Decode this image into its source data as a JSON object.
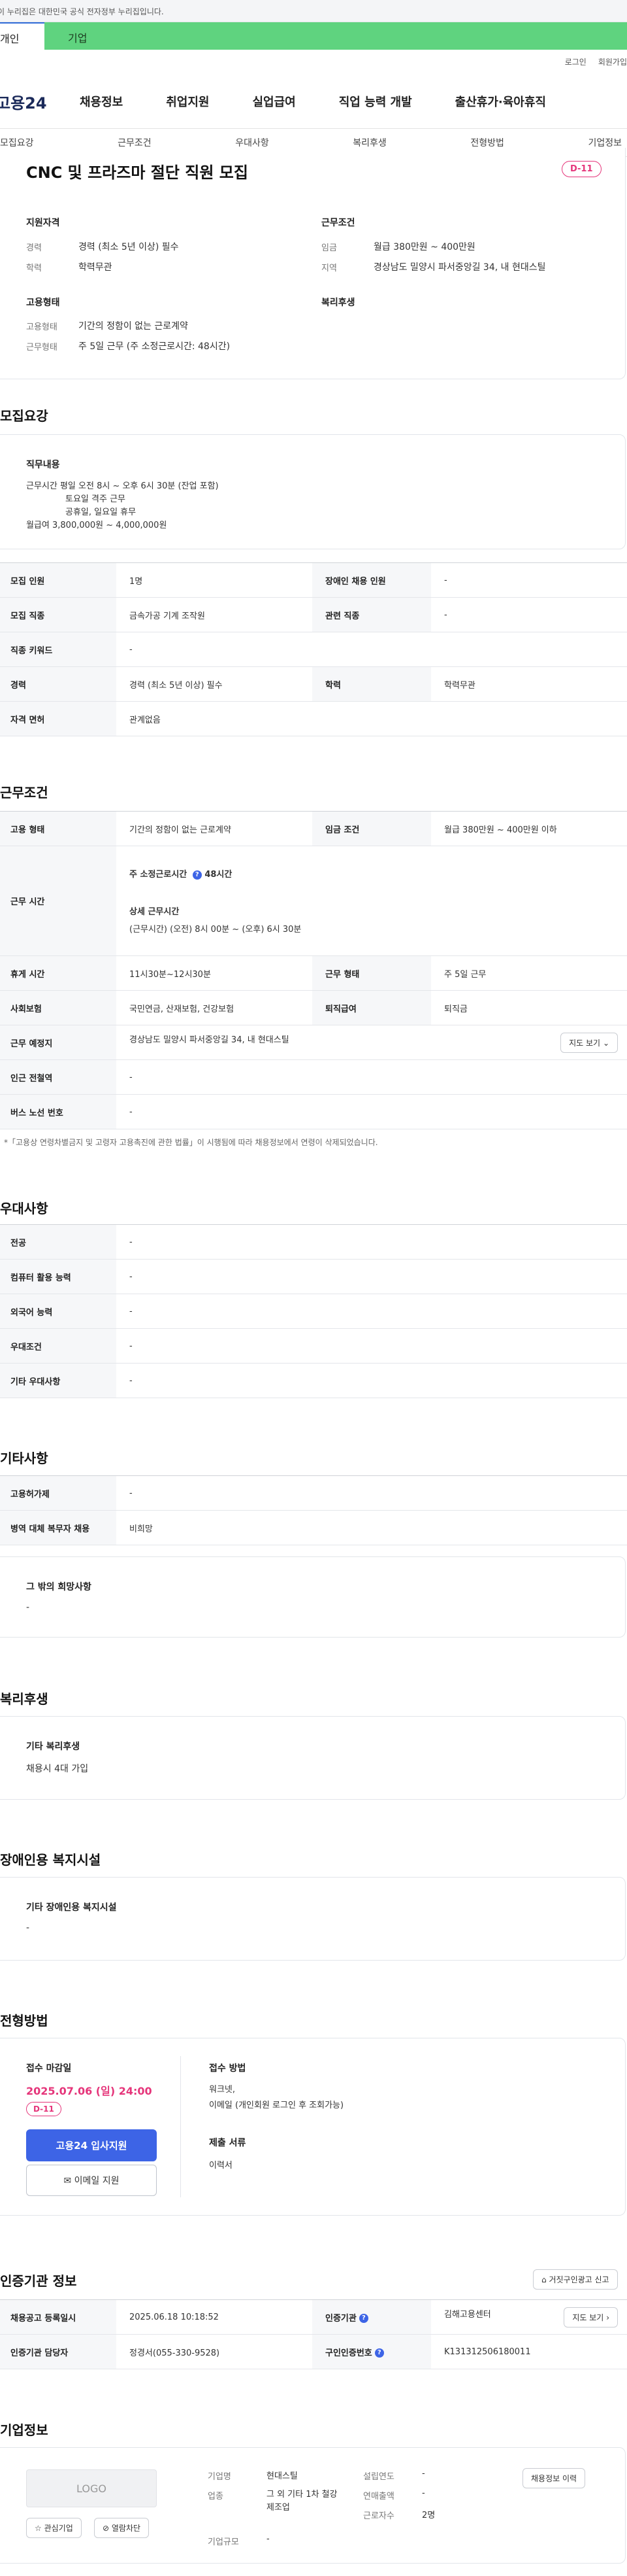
{
  "gov_banner": "이 누리집은 대한민국 공식 전자정부 누리집입니다.",
  "tabs": {
    "personal": "개인",
    "company": "기업"
  },
  "util": {
    "login": "로그인",
    "signup": "회원가입"
  },
  "logo": "고용24",
  "gnb": [
    "채용정보",
    "취업지원",
    "실업급여",
    "직업 능력 개발",
    "출산휴가·육아휴직"
  ],
  "subnav": [
    "모집요강",
    "근무조건",
    "우대사항",
    "복리후생",
    "전형방법",
    "기업정보"
  ],
  "summary": {
    "title": "CNC 및 프라즈마 절단 직원 모집",
    "dday": "D-11",
    "qualification_label": "지원자격",
    "career_k": "경력",
    "career_v": "경력 (최소 5년 이상) 필수",
    "edu_k": "학력",
    "edu_v": "학력무관",
    "workcond_label": "근무조건",
    "wage_k": "임금",
    "wage_v": "월급 380만원 ~ 400만원",
    "region_k": "지역",
    "region_v": "경상남도 밀양시 파서중앙길 34, 내 현대스틸",
    "emptype_label": "고용형태",
    "emp_k": "고용형태",
    "emp_v": "기간의 정함이 없는 근로계약",
    "worktype_k": "근무형태",
    "worktype_v": "주 5일 근무 (주 소정근로시간: 48시간)",
    "welfare_label": "복리후생"
  },
  "recruit": {
    "title": "모집요강",
    "duty_label": "직무내용",
    "duty_lines": [
      "근무시간 평일 오전 8시 ~ 오후 6시 30분 (잔업 포함)",
      "토요일 격주 근무",
      "공휴일, 일요일 휴무",
      "월급여 3,800,000원 ~ 4,000,000원"
    ],
    "rows": [
      [
        "모집 인원",
        "1명",
        "장애인 채용 인원",
        "-"
      ],
      [
        "모집 직종",
        "금속가공 기계 조작원",
        "관련 직종",
        "-"
      ],
      [
        "직종 키워드",
        "-",
        "",
        ""
      ],
      [
        "경력",
        "경력 (최소 5년 이상) 필수",
        "학력",
        "학력무관"
      ],
      [
        "자격 면허",
        "관계없음",
        "",
        ""
      ]
    ]
  },
  "workcond": {
    "title": "근무조건",
    "emp_type_k": "고용 형태",
    "emp_type_v": "기간의 정함이 없는 근로계약",
    "wage_k": "임금 조건",
    "wage_v": "월급 380만원 ~ 400만원 이하",
    "hours_k": "근무 시간",
    "hours_weekly": "주 소정근로시간",
    "hours_weekly_v": "48시간",
    "hours_detail_label": "상세 근무시간",
    "hours_detail_v": "(근무시간) (오전) 8시 00분 ~ (오후) 6시 30분",
    "break_k": "휴게 시간",
    "break_v": "11시30분~12시30분",
    "worktype_k": "근무 형태",
    "worktype_v": "주 5일 근무",
    "insurance_k": "사회보험",
    "insurance_v": "국민연금, 산재보험, 건강보험",
    "severance_k": "퇴직급여",
    "severance_v": "퇴직금",
    "location_k": "근무 예정지",
    "location_v": "경상남도 밀양시 파서중앙길 34, 내 현대스틸",
    "map_btn": "지도 보기",
    "subway_k": "인근 전철역",
    "subway_v": "-",
    "bus_k": "버스 노선 번호",
    "bus_v": "-",
    "note": "*「고용상 연령차별금지 및 고령자 고용촉진에 관한 법률」이 시행됨에 따라 채용정보에서 연령이 삭제되었습니다."
  },
  "preference": {
    "title": "우대사항",
    "rows": [
      [
        "전공",
        "-"
      ],
      [
        "컴퓨터 활용 능력",
        "-"
      ],
      [
        "외국어 능력",
        "-"
      ],
      [
        "우대조건",
        "-"
      ],
      [
        "기타 우대사항",
        "-"
      ]
    ]
  },
  "etc": {
    "title": "기타사항",
    "rows": [
      [
        "고용허가제",
        "-"
      ],
      [
        "병역 대체 복무자 채용",
        "비희망"
      ]
    ],
    "wish_label": "그 밖의 희망사항",
    "wish_v": "-"
  },
  "welfare": {
    "title": "복리후생",
    "label": "기타 복리후생",
    "value": "채용시 4대 가입"
  },
  "disability": {
    "title": "장애인용 복지시설",
    "label": "기타 장애인용 복지시설",
    "value": "-"
  },
  "selection": {
    "title": "전형방법",
    "deadline_label": "접수 마감일",
    "deadline_date": "2025.07.06 (일) 24:00",
    "dday": "D-11",
    "apply_btn": "고용24 입사지원",
    "mail_btn": "이메일 지원",
    "method_label": "접수 방법",
    "method_v1": "워크넷,",
    "method_v2": "이메일 (개인회원 로그인 후 조회가능)",
    "docs_label": "제출 서류",
    "docs_v": "이력서"
  },
  "cert": {
    "title": "인증기관 정보",
    "report_btn": "거짓구인광고 신고",
    "reg_k": "채용공고 등록일시",
    "reg_v": "2025.06.18 10:18:52",
    "org_k": "인증기관",
    "org_v": "김해고용센터",
    "map_btn": "지도 보기",
    "manager_k": "인증기관 담당자",
    "manager_v": "정경서(055-330-9528)",
    "auth_k": "구인인증번호",
    "auth_v": "K131312506180011"
  },
  "company": {
    "title": "기업정보",
    "logo_text": "LOGO",
    "fav_btn": "관심기업",
    "block_btn": "열람차단",
    "name_k": "기업명",
    "name_v": "현대스틸",
    "industry_k": "업종",
    "industry_v": "그 외 기타 1차 철강 제조업",
    "size_k": "기업규모",
    "size_v": "-",
    "founded_k": "설립연도",
    "founded_v": "-",
    "sales_k": "연매출액",
    "sales_v": "-",
    "employees_k": "근로자수",
    "employees_v": "2명",
    "jobs_btn": "채용정보 이력"
  }
}
